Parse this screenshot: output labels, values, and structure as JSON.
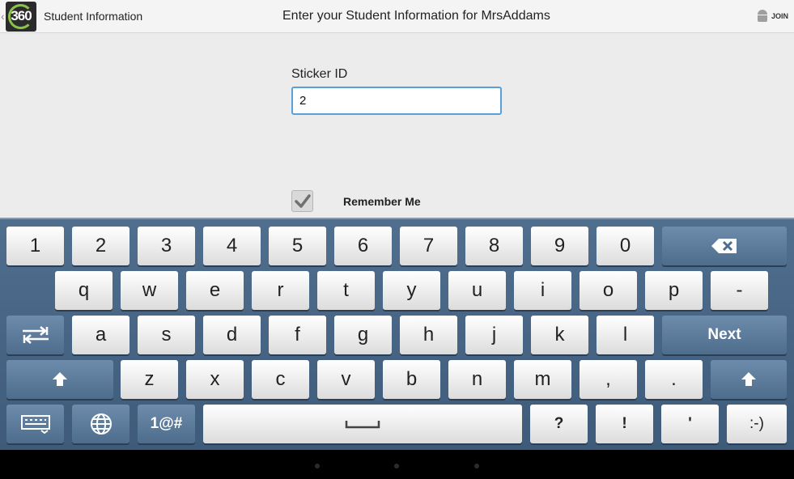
{
  "actionbar": {
    "logo_text": "360",
    "title": "Student Information",
    "center_title": "Enter your Student Information for MrsAddams",
    "join_label": "JOIN"
  },
  "form": {
    "sticker_label": "Sticker ID",
    "sticker_value": "2",
    "remember_label": "Remember Me",
    "remember_checked": true
  },
  "keyboard": {
    "row1": [
      "1",
      "2",
      "3",
      "4",
      "5",
      "6",
      "7",
      "8",
      "9",
      "0"
    ],
    "row2": [
      "q",
      "w",
      "e",
      "r",
      "t",
      "y",
      "u",
      "i",
      "o",
      "p",
      "-"
    ],
    "row3": [
      "a",
      "s",
      "d",
      "f",
      "g",
      "h",
      "j",
      "k",
      "l"
    ],
    "next_label": "Next",
    "row4": [
      "z",
      "x",
      "c",
      "v",
      "b",
      "n",
      "m",
      ",",
      "."
    ],
    "symbols_label": "1@#",
    "row5_right": [
      "?",
      "!",
      "'",
      ":-)"
    ],
    "icons": {
      "backspace": "backspace-icon",
      "tab": "tab-switch-icon",
      "shift": "shift-icon",
      "keyboard_settings": "keyboard-settings-icon",
      "language": "globe-icon",
      "space": "space-bar-icon"
    }
  },
  "colors": {
    "accent": "#5aa0d8",
    "keyboard_bg": "#4a6888",
    "logo_ring": "#8bc34a"
  }
}
